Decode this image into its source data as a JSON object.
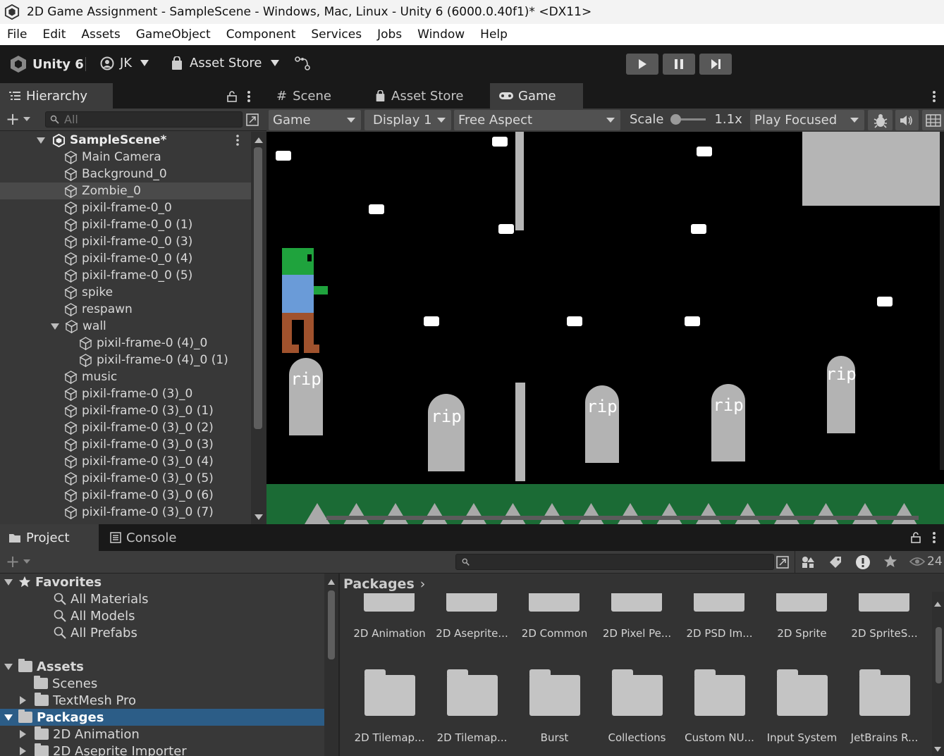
{
  "window": {
    "title": "2D Game Assignment - SampleScene - Windows, Mac, Linux - Unity 6 (6000.0.40f1)* <DX11>"
  },
  "menu": [
    "File",
    "Edit",
    "Assets",
    "GameObject",
    "Component",
    "Services",
    "Jobs",
    "Window",
    "Help"
  ],
  "toolbar": {
    "unity_label": "Unity 6",
    "account": "JK",
    "asset_store": "Asset Store"
  },
  "hierarchy": {
    "tab": "Hierarchy",
    "search_placeholder": "All",
    "scene": "SampleScene*",
    "items": [
      {
        "label": "Main Camera",
        "depth": 1
      },
      {
        "label": "Background_0",
        "depth": 1
      },
      {
        "label": "Zombie_0",
        "depth": 1,
        "selected": true
      },
      {
        "label": "pixil-frame-0_0",
        "depth": 1
      },
      {
        "label": "pixil-frame-0_0 (1)",
        "depth": 1
      },
      {
        "label": "pixil-frame-0_0 (3)",
        "depth": 1
      },
      {
        "label": "pixil-frame-0_0 (4)",
        "depth": 1
      },
      {
        "label": "pixil-frame-0_0 (5)",
        "depth": 1
      },
      {
        "label": "spike",
        "depth": 1
      },
      {
        "label": "respawn",
        "depth": 1
      },
      {
        "label": "wall",
        "depth": 1,
        "expanded": true
      },
      {
        "label": "pixil-frame-0 (4)_0",
        "depth": 2
      },
      {
        "label": "pixil-frame-0 (4)_0 (1)",
        "depth": 2
      },
      {
        "label": "music",
        "depth": 1
      },
      {
        "label": "pixil-frame-0 (3)_0",
        "depth": 1
      },
      {
        "label": "pixil-frame-0 (3)_0 (1)",
        "depth": 1
      },
      {
        "label": "pixil-frame-0 (3)_0 (2)",
        "depth": 1
      },
      {
        "label": "pixil-frame-0 (3)_0 (3)",
        "depth": 1
      },
      {
        "label": "pixil-frame-0 (3)_0 (4)",
        "depth": 1
      },
      {
        "label": "pixil-frame-0 (3)_0 (5)",
        "depth": 1
      },
      {
        "label": "pixil-frame-0 (3)_0 (6)",
        "depth": 1
      },
      {
        "label": "pixil-frame-0 (3)_0 (7)",
        "depth": 1
      }
    ]
  },
  "views": {
    "tabs": [
      "Scene",
      "Asset Store",
      "Game"
    ],
    "active_tab": "Game",
    "game_toolbar": {
      "mode": "Game",
      "display": "Display 1",
      "aspect": "Free Aspect",
      "scale_label": "Scale",
      "scale_value": "1.1x",
      "play_mode": "Play Focused"
    },
    "tombstone_text": "rip"
  },
  "project": {
    "tabs": [
      "Project",
      "Console"
    ],
    "hidden_count": "24",
    "breadcrumb": "Packages",
    "tree": [
      {
        "label": "Favorites",
        "type": "header",
        "icon": "star-icon",
        "expanded": true
      },
      {
        "label": "All Materials",
        "type": "search",
        "depth": 1
      },
      {
        "label": "All Models",
        "type": "search",
        "depth": 1
      },
      {
        "label": "All Prefabs",
        "type": "search",
        "depth": 1
      },
      {
        "label": "Assets",
        "type": "folder",
        "expanded": true
      },
      {
        "label": "Scenes",
        "type": "folder",
        "depth": 1
      },
      {
        "label": "TextMesh Pro",
        "type": "folder",
        "depth": 1,
        "collapsed": true
      },
      {
        "label": "Packages",
        "type": "folder",
        "expanded": true,
        "selected": true
      },
      {
        "label": "2D Animation",
        "type": "folder",
        "depth": 1,
        "collapsed": true
      },
      {
        "label": "2D Aseprite Importer",
        "type": "folder",
        "depth": 1,
        "collapsed": true
      }
    ],
    "grid_row1": [
      "2D Animation",
      "2D Aseprite...",
      "2D Common",
      "2D Pixel Pe...",
      "2D PSD Im...",
      "2D Sprite",
      "2D SpriteS..."
    ],
    "grid_row2": [
      "2D Tilemap...",
      "2D Tilemap...",
      "Burst",
      "Collections",
      "Custom NU...",
      "Input System",
      "JetBrains R..."
    ]
  },
  "colors": {
    "selection_blue": "#2c5d87",
    "zombie_head": "#1fa33d",
    "zombie_body": "#6a9bd8",
    "zombie_legs": "#a0522d",
    "grass": "#1b6b35"
  }
}
